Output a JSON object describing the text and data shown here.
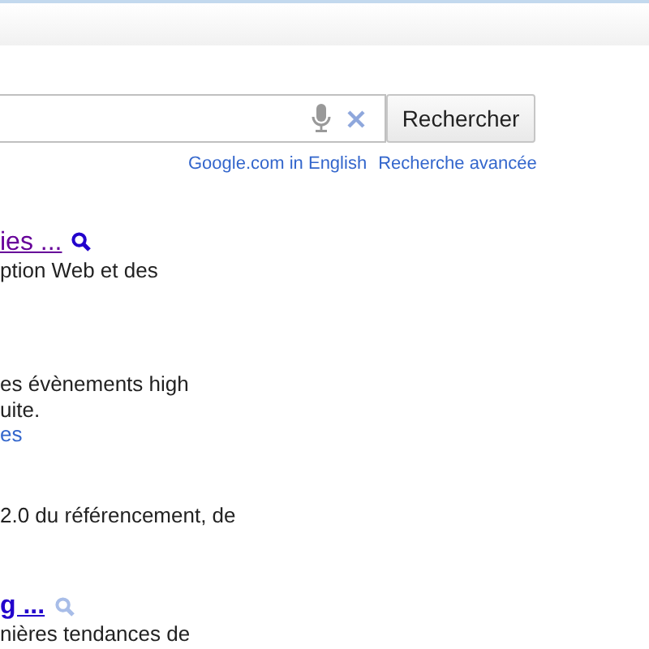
{
  "search": {
    "button": "Rechercher",
    "links": [
      "Google.com in English",
      "Recherche avancée"
    ]
  },
  "results": [
    {
      "title": "ies ...",
      "visited": true,
      "preview_active": true,
      "lines": [
        "ption Web et des"
      ]
    },
    {
      "lines": [
        "es évènements high",
        "uite."
      ],
      "link": "es"
    },
    {
      "lines": [
        "2.0 du référencement, de"
      ]
    },
    {
      "title": "g ...",
      "visited": false,
      "preview_active": false,
      "lines": [
        "nières tendances de"
      ]
    }
  ]
}
